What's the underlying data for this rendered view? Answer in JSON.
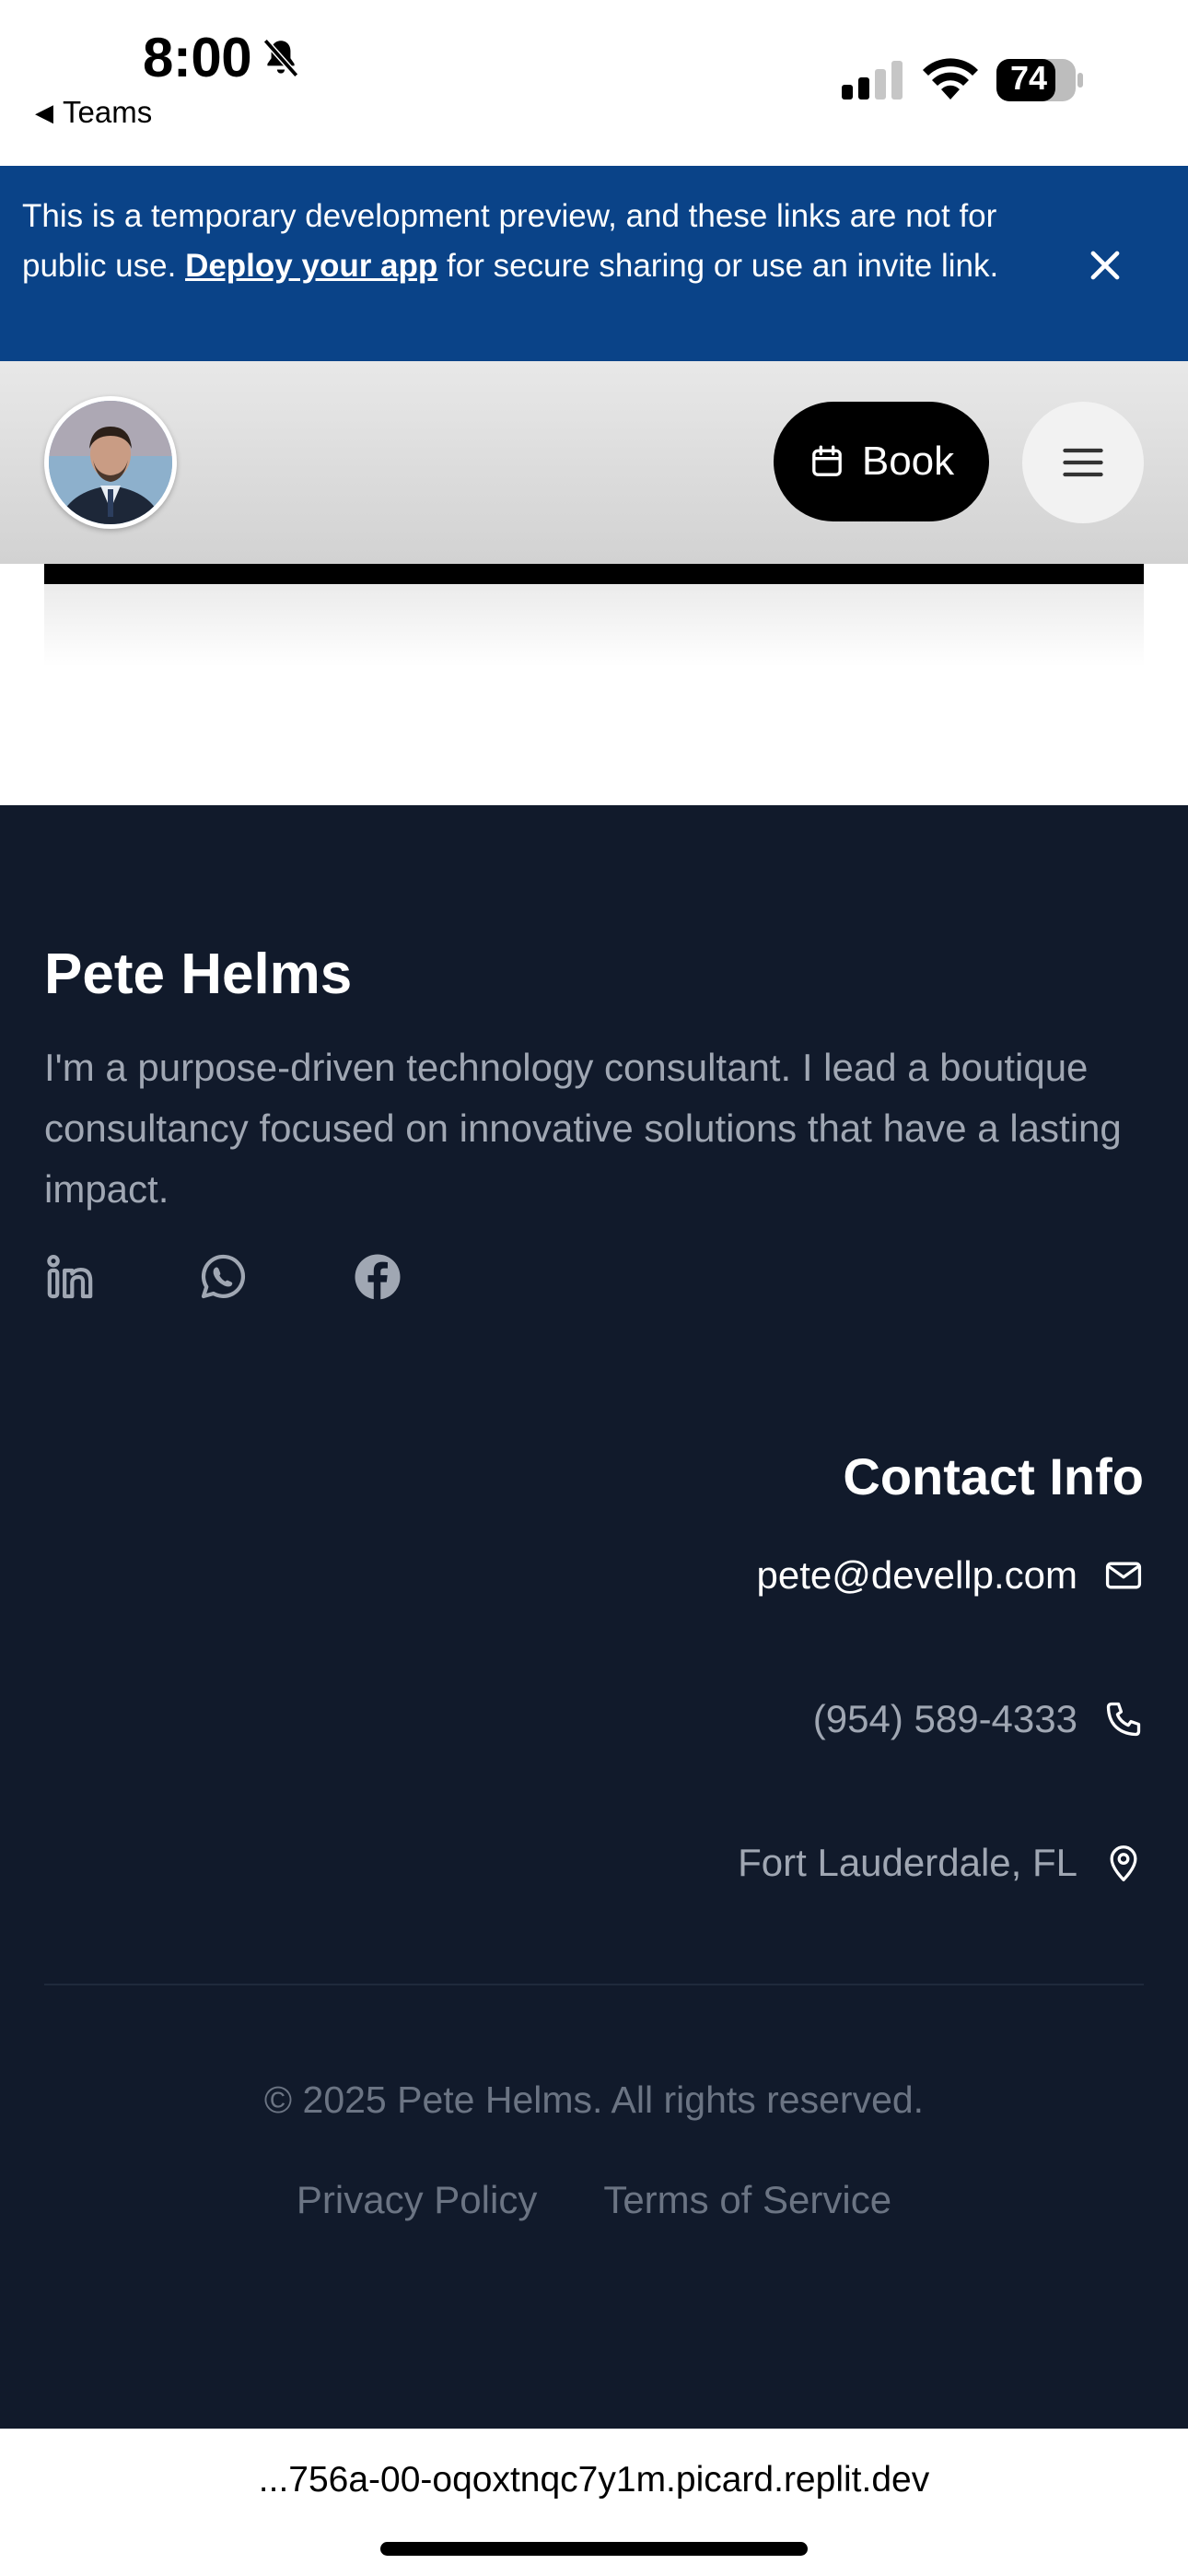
{
  "status_bar": {
    "time": "8:00",
    "back_label": "Teams",
    "battery": "74",
    "icons": [
      "bell-slash-icon",
      "signal-icon",
      "wifi-icon",
      "battery-icon"
    ]
  },
  "banner": {
    "text_before": "This is a temporary development preview, and these links are not for public use.",
    "link": "Deploy your app",
    "text_after": "for secure sharing or use an invite link.",
    "close_icon": "close-icon",
    "background": "#0a4388"
  },
  "header": {
    "avatar_alt": "profile-photo",
    "book_label": "Book",
    "book_icon": "calendar-icon",
    "menu_icon": "hamburger-menu-icon"
  },
  "footer": {
    "name": "Pete Helms",
    "bio": "I'm a purpose-driven technology consultant. I lead a boutique consultancy focused on innovative solutions that have a lasting impact.",
    "social": [
      "linkedin-icon",
      "whatsapp-icon",
      "facebook-icon"
    ],
    "contact_title": "Contact Info",
    "contacts": [
      {
        "text": "pete@devellp.com",
        "icon": "mail-icon"
      },
      {
        "text": "(954) 589-4333",
        "icon": "phone-icon"
      },
      {
        "text": "Fort Lauderdale, FL",
        "icon": "map-pin-icon"
      }
    ],
    "copyright": "© 2025 Pete Helms. All rights reserved.",
    "links": [
      "Privacy Policy",
      "Terms of Service"
    ],
    "background": "#111a2b"
  },
  "browser": {
    "url": "...756a-00-oqoxtnqc7y1m.picard.replit.dev"
  }
}
